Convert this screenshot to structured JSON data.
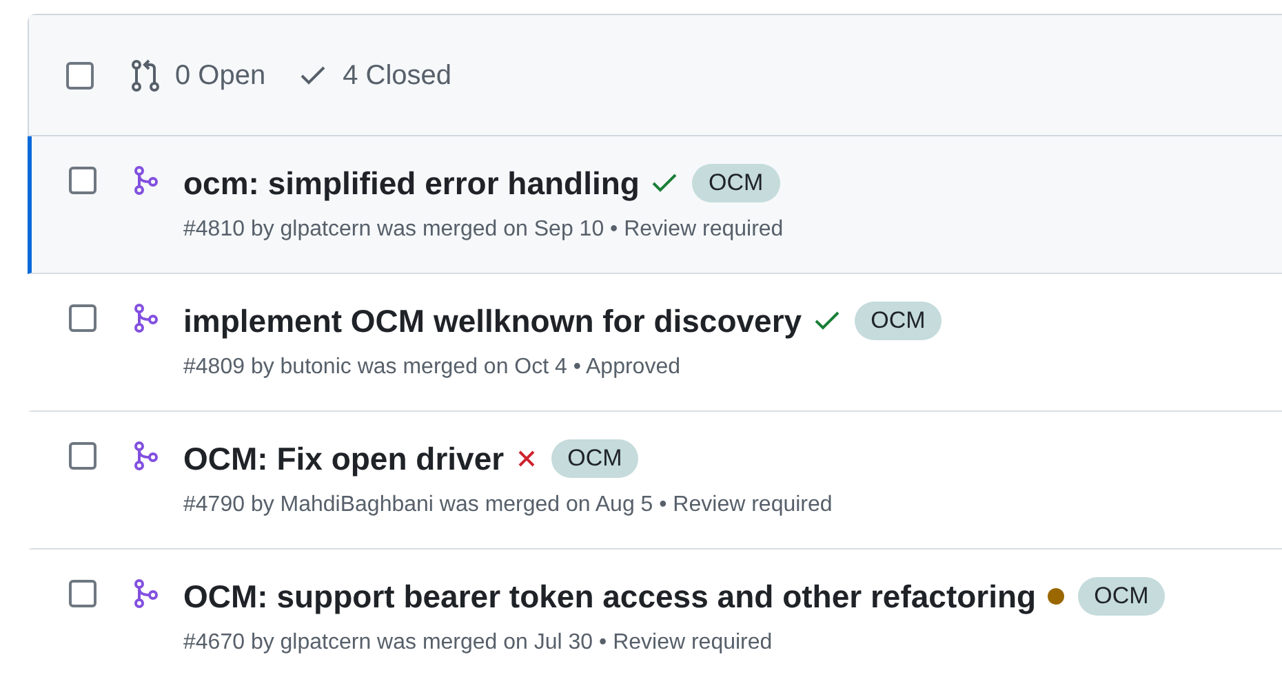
{
  "header": {
    "select_all": {
      "checked": false
    },
    "open": "0 Open",
    "closed": "4 Closed"
  },
  "pull_requests": [
    {
      "title": "ocm: simplified error handling",
      "status": {
        "kind": "success"
      },
      "label": "OCM",
      "meta": "#4810 by glpatcern was merged on Sep 10 • Review required",
      "selected": true,
      "checked": false
    },
    {
      "title": "implement OCM wellknown for discovery",
      "status": {
        "kind": "success"
      },
      "label": "OCM",
      "meta": "#4809 by butonic was merged on Oct 4 • Approved",
      "selected": false,
      "checked": false
    },
    {
      "title": "OCM: Fix open driver",
      "status": {
        "kind": "failure"
      },
      "label": "OCM",
      "meta": "#4790 by MahdiBaghbani was merged on Aug 5 • Review required",
      "selected": false,
      "checked": false
    },
    {
      "title": "OCM: support bearer token access and other refactoring",
      "status": {
        "kind": "pending"
      },
      "label": "OCM",
      "meta": "#4670 by glpatcern was merged on Jul 30 • Review required",
      "selected": false,
      "checked": false
    }
  ]
}
